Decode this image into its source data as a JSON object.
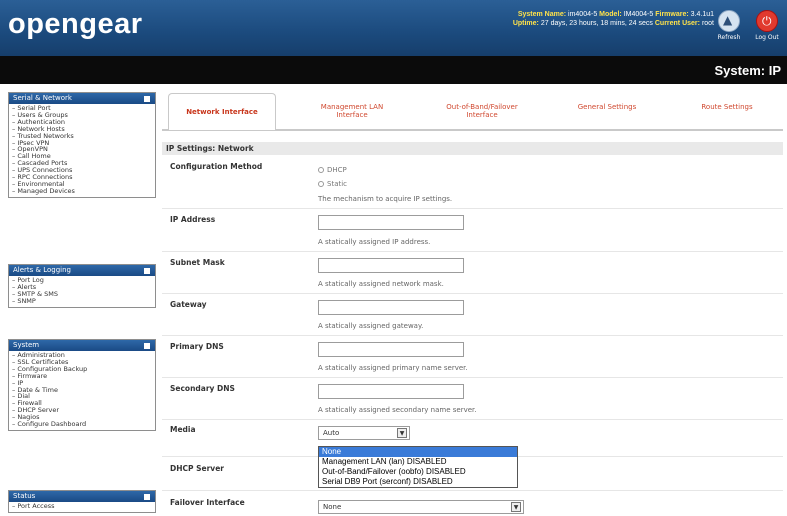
{
  "header": {
    "logo": "opengear",
    "system_name_label": "System Name:",
    "system_name": "im4004-5",
    "model_label": "Model:",
    "model": "IM4004-5",
    "firmware_label": "Firmware:",
    "firmware": "3.4.1u1",
    "uptime_label": "Uptime:",
    "uptime": "27 days, 23 hours, 18 mins, 24 secs",
    "user_label": "Current User:",
    "user": "root",
    "refresh_label": "Refresh",
    "logout_label": "Log Out"
  },
  "page_heading": "System: IP",
  "sidebar": {
    "serial_network": {
      "title": "Serial & Network",
      "items": [
        "Serial Port",
        "Users & Groups",
        "Authentication",
        "Network Hosts",
        "Trusted Networks",
        "IPsec VPN",
        "OpenVPN",
        "Call Home",
        "Cascaded Ports",
        "UPS Connections",
        "RPC Connections",
        "Environmental",
        "Managed Devices"
      ]
    },
    "alerts_logging": {
      "title": "Alerts & Logging",
      "items": [
        "Port Log",
        "Alerts",
        "SMTP & SMS",
        "SNMP"
      ]
    },
    "system": {
      "title": "System",
      "items": [
        "Administration",
        "SSL Certificates",
        "Configuration Backup",
        "Firmware",
        "IP",
        "Date & Time",
        "Dial",
        "Firewall",
        "DHCP Server",
        "Nagios",
        "Configure Dashboard"
      ]
    },
    "status": {
      "title": "Status",
      "items": [
        "Port Access"
      ]
    }
  },
  "tabs": [
    {
      "line1": "Network Interface",
      "line2": ""
    },
    {
      "line1": "Management LAN",
      "line2": "Interface"
    },
    {
      "line1": "Out-of-Band/Failover",
      "line2": "Interface"
    },
    {
      "line1": "General Settings",
      "line2": ""
    },
    {
      "line1": "Route Settings",
      "line2": ""
    }
  ],
  "form": {
    "section_title": "IP Settings: Network",
    "config_method": {
      "label": "Configuration Method",
      "option_dhcp": "DHCP",
      "option_static": "Static",
      "help": "The mechanism to acquire IP settings."
    },
    "ip_address": {
      "label": "IP Address",
      "value": "",
      "help": "A statically assigned IP address."
    },
    "subnet_mask": {
      "label": "Subnet Mask",
      "value": "",
      "help": "A statically assigned network mask."
    },
    "gateway": {
      "label": "Gateway",
      "value": "",
      "help": "A statically assigned gateway."
    },
    "primary_dns": {
      "label": "Primary DNS",
      "value": "",
      "help": "A statically assigned primary name server."
    },
    "secondary_dns": {
      "label": "Secondary DNS",
      "value": "",
      "help": "A statically assigned secondary name server."
    },
    "media": {
      "label": "Media",
      "value": "Auto"
    },
    "dhcp_server": {
      "label": "DHCP Server"
    },
    "failover_interface": {
      "label": "Failover Interface",
      "value": "None",
      "options": [
        "None",
        "Management LAN (lan) DISABLED",
        "Out-of-Band/Failover (oobfo) DISABLED",
        "Serial DB9 Port (serconf) DISABLED"
      ]
    }
  }
}
